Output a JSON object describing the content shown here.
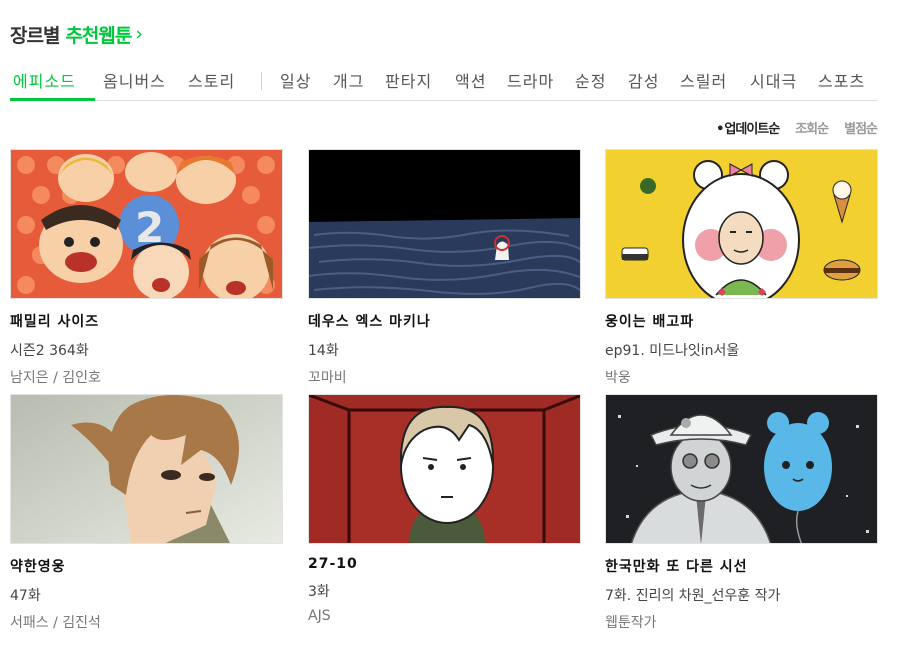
{
  "heading": {
    "prefix": "장르별",
    "link": "추천웹툰"
  },
  "tabs": [
    "에피소드",
    "옴니버스",
    "스토리",
    "일상",
    "개그",
    "판타지",
    "액션",
    "드라마",
    "순정",
    "감성",
    "스릴러",
    "시대극",
    "스포츠"
  ],
  "active_tab": "에피소드",
  "sort": [
    "업데이트순",
    "조회순",
    "별점순"
  ],
  "active_sort": "업데이트순",
  "cards": [
    {
      "title": "패밀리 사이즈",
      "episode": "시즌2 364화",
      "author": "남지은 / 김인호"
    },
    {
      "title": "데우스 엑스 마키나",
      "episode": "14화",
      "author": "꼬마비"
    },
    {
      "title": "웅이는 배고파",
      "episode": "ep91. 미드나잇in서울",
      "author": "박웅"
    },
    {
      "title": "약한영웅",
      "episode": "47화",
      "author": "서패스 / 김진석"
    },
    {
      "title": "27-10",
      "episode": "3화",
      "author": "AJS"
    },
    {
      "title": "한국만화 또 다른 시선",
      "episode": "7화. 진리의 차원_선우훈 작가",
      "author": "웹툰작가"
    }
  ],
  "colors": {
    "accent": "#00c73c",
    "text": "#222222",
    "muted": "#777777"
  }
}
